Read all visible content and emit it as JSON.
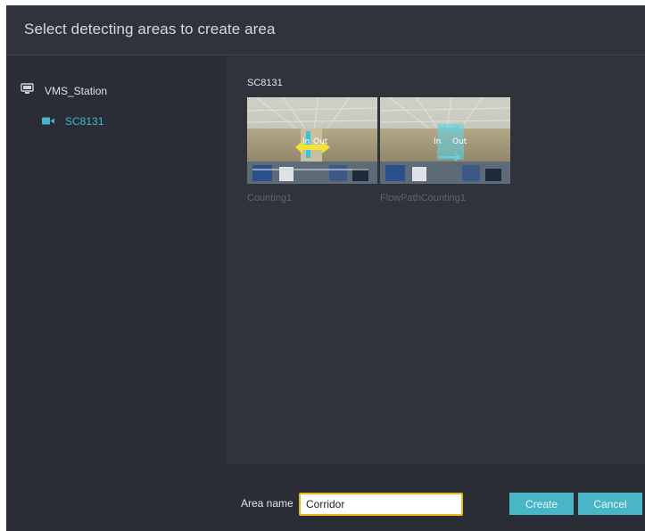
{
  "dialog": {
    "title": "Select detecting areas to create area"
  },
  "tree": {
    "station": {
      "label": "VMS_Station",
      "icon": "monitor-icon"
    },
    "camera": {
      "label": "SC8131",
      "icon": "video-camera-icon"
    }
  },
  "content": {
    "section_title": "SC8131",
    "thumbnails": [
      {
        "label": "Counting1",
        "overlay_in": "In",
        "overlay_out": "Out",
        "arrow_color": "#f2e23a"
      },
      {
        "label": "FlowPathCounting1",
        "overlay_in": "In",
        "overlay_out": "Out",
        "arrow_color": "#5fd3e6"
      }
    ]
  },
  "footer": {
    "area_name_label": "Area name",
    "area_name_value": "Corridor",
    "create_label": "Create",
    "cancel_label": "Cancel"
  },
  "colors": {
    "accent": "#49b6c8",
    "input_border": "#e8b81f",
    "camera_text": "#46b4cc"
  }
}
